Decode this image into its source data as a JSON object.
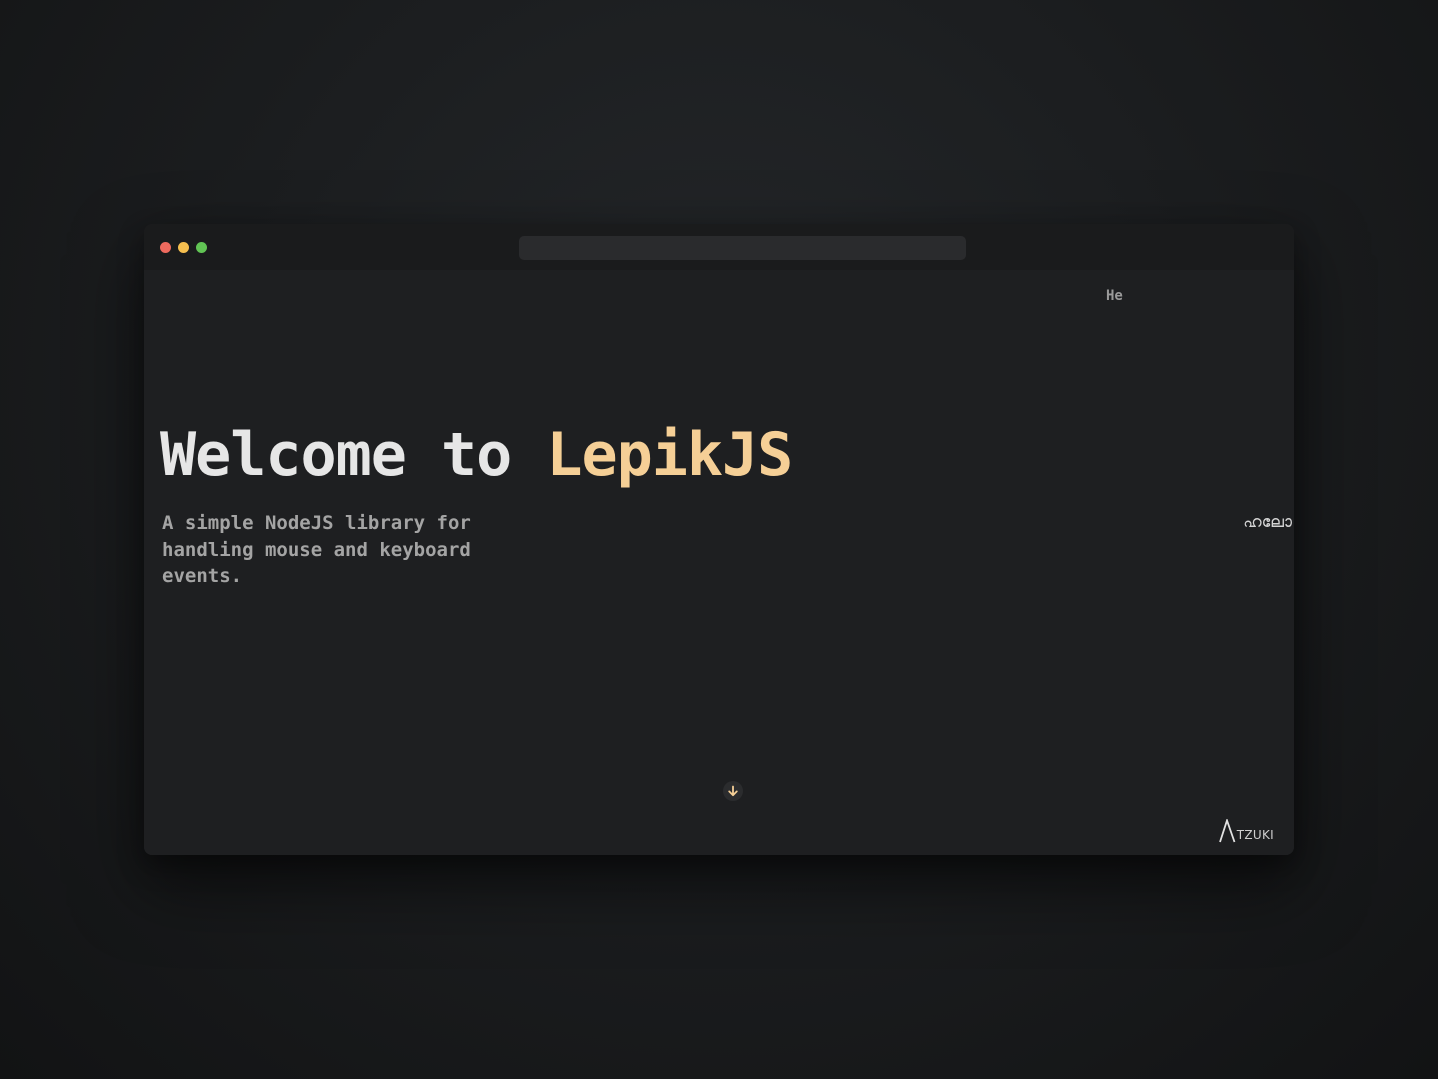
{
  "colors": {
    "page_background": "#1c1e20",
    "window_background": "#1e1f21",
    "titlebar_background": "#1a1b1c",
    "address_bar": "#2a2b2d",
    "traffic_red": "#ee6a5e",
    "traffic_yellow": "#f5bf4f",
    "traffic_green": "#61c454",
    "accent": "#f5cf96",
    "title_text": "#e6e6e6",
    "subtitle_text": "#a4a4a4"
  },
  "window": {
    "address_bar": {
      "value": ""
    }
  },
  "hero": {
    "title_prefix": "Welcome to ",
    "title_accent": "LepikJS",
    "subtitle": "A simple NodeJS library for handling mouse and keyboard events."
  },
  "greetings": {
    "top": "He",
    "right": "ഹലോ"
  },
  "scroll_down": {
    "icon": "arrow-down-icon"
  },
  "logo": {
    "text": "TZUKI",
    "icon": "lambda-logo-icon"
  }
}
